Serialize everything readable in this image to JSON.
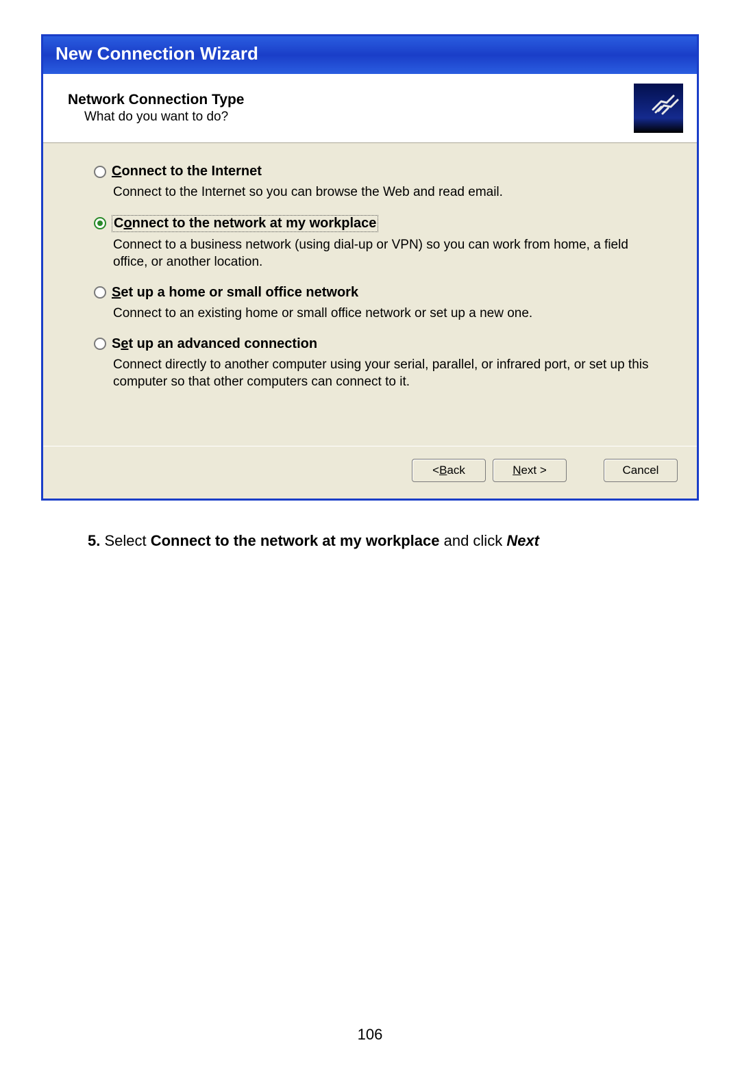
{
  "titlebar": "New Connection Wizard",
  "header": {
    "title": "Network Connection Type",
    "subtitle": "What do you want to do?"
  },
  "options": [
    {
      "label_pre": "",
      "label_ul": "C",
      "label_post": "onnect to the Internet",
      "desc": "Connect to the Internet so you can browse the Web and read email.",
      "selected": false,
      "focused": false
    },
    {
      "label_pre": "C",
      "label_ul": "o",
      "label_post": "nnect to the network at my workplace",
      "desc": "Connect to a business network (using dial-up or VPN) so you can work from home, a field office, or another location.",
      "selected": true,
      "focused": true
    },
    {
      "label_pre": "",
      "label_ul": "S",
      "label_post": "et up a home or small office network",
      "desc": "Connect to an existing home or small office network or set up a new one.",
      "selected": false,
      "focused": false
    },
    {
      "label_pre": "S",
      "label_ul": "e",
      "label_post": "t up an advanced connection",
      "desc": "Connect directly to another computer using your serial, parallel, or infrared port, or set up this computer so that other computers can connect to it.",
      "selected": false,
      "focused": false
    }
  ],
  "buttons": {
    "back_pre": "< ",
    "back_ul": "B",
    "back_post": "ack",
    "next_pre": "",
    "next_ul": "N",
    "next_post": "ext >",
    "cancel": "Cancel"
  },
  "instruction": {
    "num": "5.",
    "pre": " Select ",
    "bold": "Connect to the network at my workplace",
    "mid": " and click ",
    "italic": "Next"
  },
  "page_number": "106"
}
